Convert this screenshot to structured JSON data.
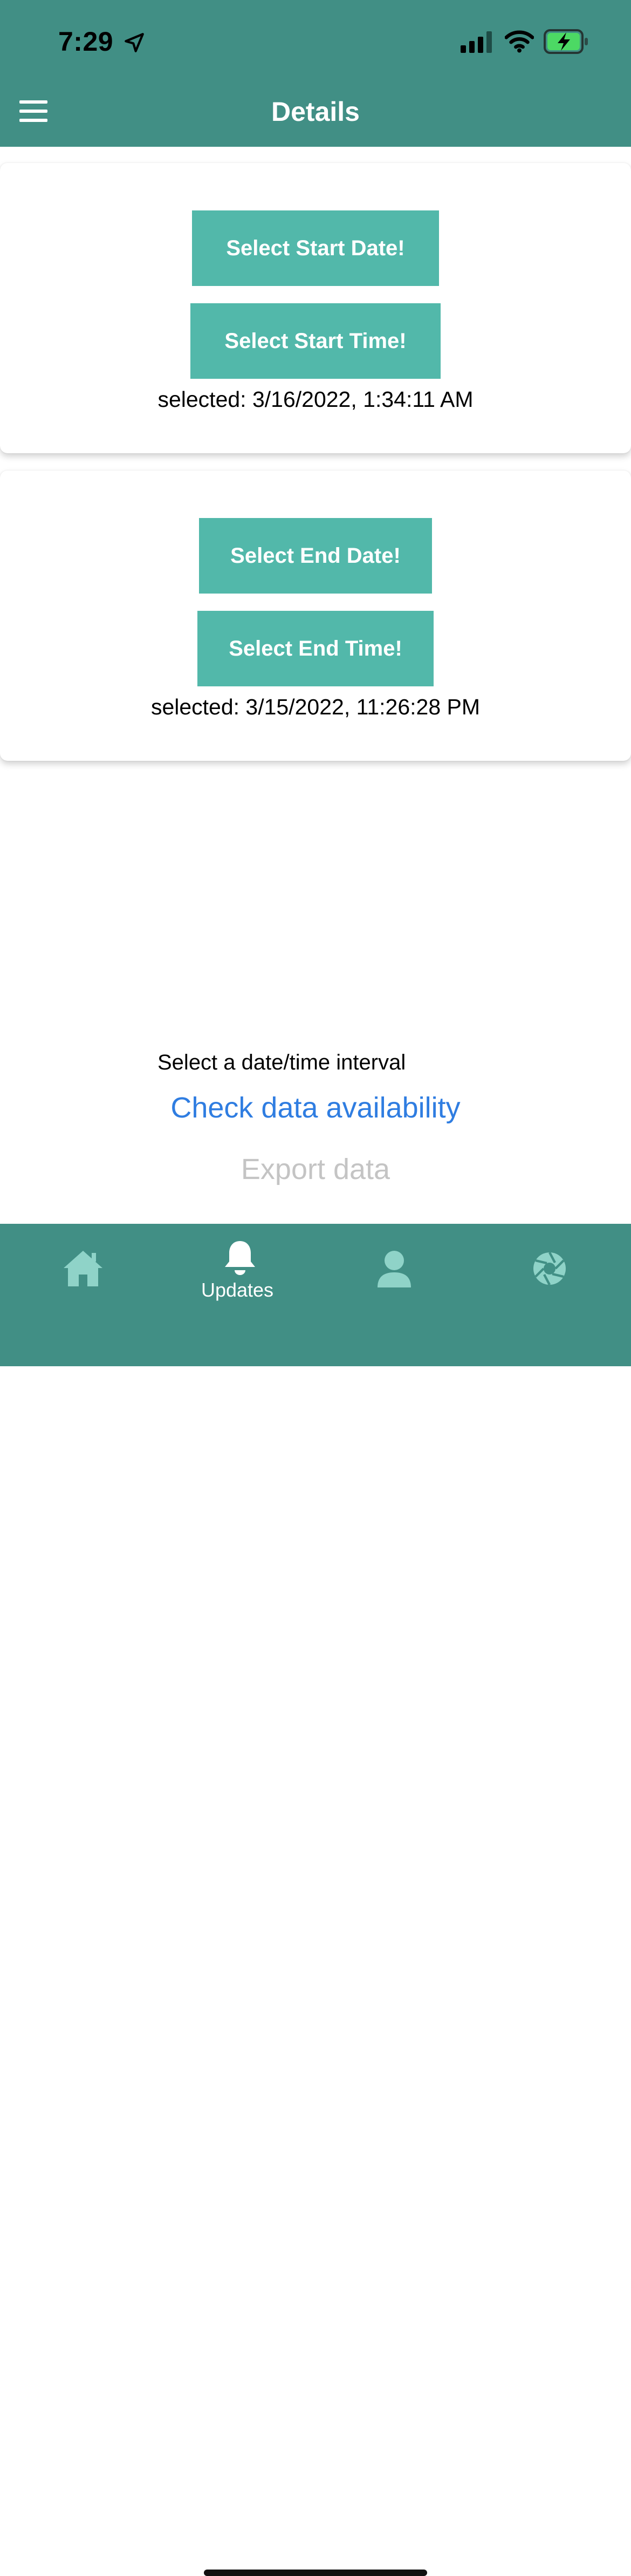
{
  "status_bar": {
    "time": "7:29"
  },
  "header": {
    "title": "Details"
  },
  "start_section": {
    "date_button": "Select Start Date!",
    "time_button": "Select Start Time!",
    "selected": "selected: 3/16/2022, 1:34:11 AM"
  },
  "end_section": {
    "date_button": "Select End Date!",
    "time_button": "Select End Time!",
    "selected": "selected: 3/15/2022, 11:26:28 PM"
  },
  "actions": {
    "interval_prompt": "Select a date/time interval",
    "check_label": "Check data availability",
    "export_label": "Export data"
  },
  "tab_bar": {
    "tabs": [
      {
        "icon": "home-icon",
        "label": "",
        "active": false
      },
      {
        "icon": "bell-icon",
        "label": "Updates",
        "active": true
      },
      {
        "icon": "person-icon",
        "label": "",
        "active": false
      },
      {
        "icon": "aperture-icon",
        "label": "",
        "active": false
      }
    ]
  },
  "colors": {
    "header_bg": "#418f85",
    "button_bg": "#52b8aa",
    "link": "#2f7de1",
    "disabled": "#c4c4c4",
    "inactive_tab_icon": "#8fd3c8",
    "battery_fill": "#4cd964"
  }
}
